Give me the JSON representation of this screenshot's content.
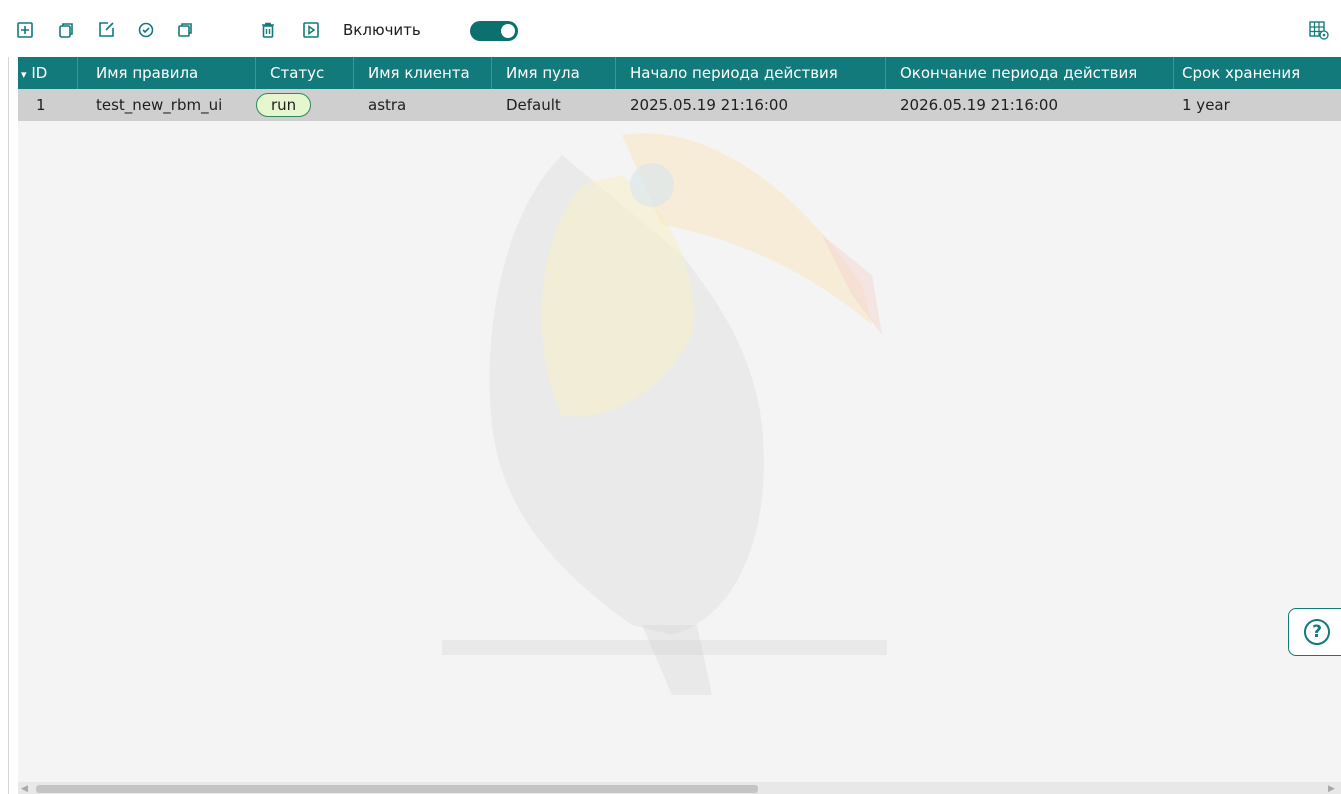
{
  "toolbar": {
    "buttons": [
      {
        "icon": "add-icon"
      },
      {
        "icon": "copy-icon"
      },
      {
        "icon": "edit-icon"
      },
      {
        "icon": "schedule-icon"
      },
      {
        "icon": "duplicate-icon"
      },
      {
        "icon": "delete-icon"
      },
      {
        "icon": "run-icon"
      }
    ],
    "enable_label": "Включить",
    "enable_toggle": true,
    "settings_icon": "grid-settings-icon"
  },
  "table": {
    "sort_indicator": "▾",
    "columns": {
      "id": "ID",
      "rule_name": "Имя правила",
      "status": "Статус",
      "client_name": "Имя клиента",
      "pool_name": "Имя пула",
      "start": "Начало периода действия",
      "end": "Окончание периода действия",
      "retention": "Срок хранения"
    },
    "rows": [
      {
        "id": "1",
        "rule_name": "test_new_rbm_ui",
        "status": "run",
        "client_name": "astra",
        "pool_name": "Default",
        "start": "2025.05.19 21:16:00",
        "end": "2026.05.19 21:16:00",
        "retention": "1 year"
      }
    ]
  },
  "help": {
    "label": "?"
  },
  "colors": {
    "accent": "#137a7b",
    "row_bg": "#cfcfcf",
    "status_bg": "#e6f7cf",
    "status_border": "#2e8b57"
  }
}
